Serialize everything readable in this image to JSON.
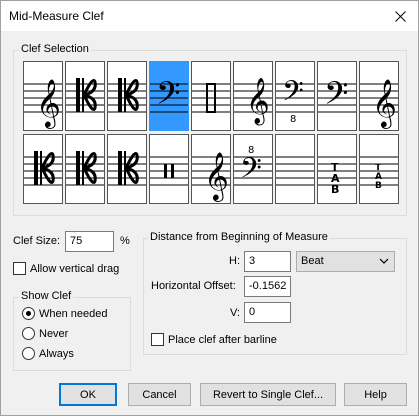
{
  "window": {
    "title": "Mid-Measure Clef"
  },
  "clef_selection": {
    "label": "Clef Selection",
    "selected_index": 3,
    "clefs": [
      {
        "icon": "treble-clef-icon"
      },
      {
        "icon": "alto-clef-icon"
      },
      {
        "icon": "tenor-clef-icon"
      },
      {
        "icon": "bass-clef-icon"
      },
      {
        "icon": "percussion-clef-icon"
      },
      {
        "icon": "treble-8vb-clef-icon"
      },
      {
        "icon": "bass-8vb-clef-icon"
      },
      {
        "icon": "baritone-f-clef-icon"
      },
      {
        "icon": "french-violin-clef-icon"
      },
      {
        "icon": "soprano-c-clef-icon"
      },
      {
        "icon": "mezzo-soprano-c-clef-icon"
      },
      {
        "icon": "baritone-c-clef-icon"
      },
      {
        "icon": "percussion-clef-2-icon"
      },
      {
        "icon": "treble-low-clef-icon"
      },
      {
        "icon": "bass-8va-clef-icon"
      },
      {
        "icon": "blank-clef-icon"
      },
      {
        "icon": "tab-clef-icon"
      },
      {
        "icon": "tab-small-clef-icon"
      }
    ]
  },
  "clef_size": {
    "label": "Clef Size:",
    "value": "75",
    "unit": "%"
  },
  "allow_vertical_drag": {
    "label": "Allow vertical drag",
    "checked": false
  },
  "show_clef": {
    "label": "Show Clef",
    "options": [
      {
        "label": "When needed",
        "checked": true
      },
      {
        "label": "Never",
        "checked": false
      },
      {
        "label": "Always",
        "checked": false
      }
    ]
  },
  "distance": {
    "label": "Distance from Beginning of Measure",
    "h_label": "H:",
    "h_value": "3",
    "unit_value": "Beat",
    "horizontal_offset_label": "Horizontal Offset:",
    "horizontal_offset_value": "-0.1562",
    "v_label": "V:",
    "v_value": "0",
    "place_after_barline_label": "Place clef after barline",
    "place_after_barline_checked": false
  },
  "buttons": {
    "ok": "OK",
    "cancel": "Cancel",
    "revert": "Revert to Single Clef...",
    "help": "Help"
  }
}
